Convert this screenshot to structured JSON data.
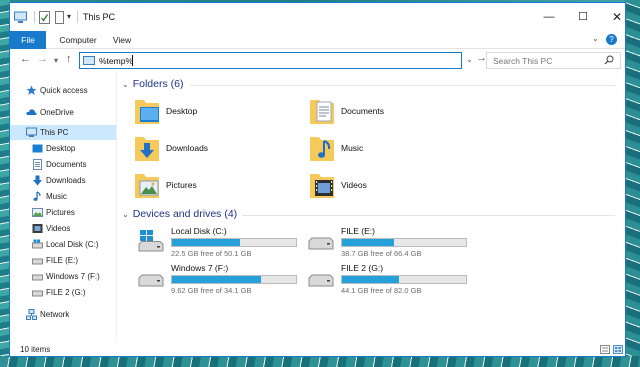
{
  "window": {
    "title": "This PC"
  },
  "ribbon": {
    "tabs": [
      "File",
      "Computer",
      "View"
    ]
  },
  "address": {
    "value": "%temp%",
    "search_placeholder": "Search This PC"
  },
  "sidebar": {
    "items": [
      {
        "label": "Quick access",
        "icon": "star-icon"
      },
      {
        "label": "OneDrive",
        "icon": "cloud-icon"
      },
      {
        "label": "This PC",
        "icon": "computer-icon",
        "selected": true
      },
      {
        "label": "Desktop",
        "icon": "desktop-folder-icon"
      },
      {
        "label": "Documents",
        "icon": "documents-icon"
      },
      {
        "label": "Downloads",
        "icon": "download-icon"
      },
      {
        "label": "Music",
        "icon": "music-icon"
      },
      {
        "label": "Pictures",
        "icon": "pictures-icon"
      },
      {
        "label": "Videos",
        "icon": "videos-icon"
      },
      {
        "label": "Local Disk (C:)",
        "icon": "drive-icon"
      },
      {
        "label": "FILE (E:)",
        "icon": "drive-icon"
      },
      {
        "label": "Windows 7 (F:)",
        "icon": "drive-icon"
      },
      {
        "label": "FILE 2 (G:)",
        "icon": "drive-icon"
      },
      {
        "label": "Network",
        "icon": "network-icon"
      }
    ]
  },
  "folders": {
    "heading": "Folders (6)",
    "items": [
      {
        "name": "Desktop",
        "icon": "desktop-folder-icon"
      },
      {
        "name": "Documents",
        "icon": "documents-folder-icon"
      },
      {
        "name": "Downloads",
        "icon": "downloads-folder-icon"
      },
      {
        "name": "Music",
        "icon": "music-folder-icon"
      },
      {
        "name": "Pictures",
        "icon": "pictures-folder-icon"
      },
      {
        "name": "Videos",
        "icon": "videos-folder-icon"
      }
    ]
  },
  "drives": {
    "heading": "Devices and drives (4)",
    "items": [
      {
        "name": "Local Disk (C:)",
        "free_text": "22.5 GB free of 50.1 GB",
        "used_fraction": 0.55,
        "windows": true
      },
      {
        "name": "FILE (E:)",
        "free_text": "38.7 GB free of 66.4 GB",
        "used_fraction": 0.42
      },
      {
        "name": "Windows 7 (F:)",
        "free_text": "9.62 GB free of 34.1 GB",
        "used_fraction": 0.72
      },
      {
        "name": "FILE 2 (G:)",
        "free_text": "44.1 GB free of 82.0 GB",
        "used_fraction": 0.46
      }
    ]
  },
  "status": {
    "items_count": "10 items"
  },
  "colors": {
    "accent": "#1979ca",
    "selection": "#cce8ff",
    "bar_fill": "#26a0da",
    "heading": "#1e3287"
  }
}
